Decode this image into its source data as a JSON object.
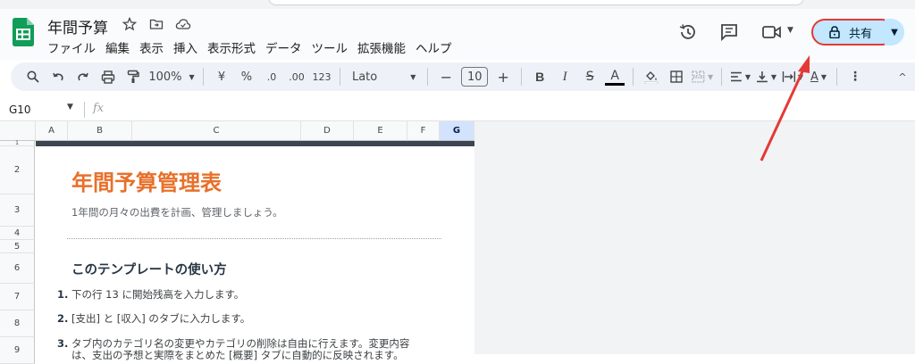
{
  "app": {
    "title": "年間予算",
    "brand_color": "#0f9d58"
  },
  "menu": [
    "ファイル",
    "編集",
    "表示",
    "挿入",
    "表示形式",
    "データ",
    "ツール",
    "拡張機能",
    "ヘルプ"
  ],
  "header_actions": {
    "share_label": "共有"
  },
  "toolbar": {
    "zoom": "100%",
    "currency": "¥",
    "percent": "%",
    "dec_decrease": ".0",
    "dec_increase": ".00",
    "number_format": "123",
    "font": "Lato",
    "font_size": "10"
  },
  "formula_bar": {
    "cell_ref": "G10",
    "fx": "fx"
  },
  "columns": [
    "A",
    "B",
    "C",
    "D",
    "E",
    "F",
    "G"
  ],
  "rows": [
    "1",
    "2",
    "3",
    "4",
    "5",
    "6",
    "7",
    "8",
    "9"
  ],
  "sheet": {
    "title": "年間予算管理表",
    "subtitle": "1年間の月々の出費を計画、管理しましょう。",
    "howto_heading": "このテンプレートの使い方",
    "steps": [
      {
        "num": "1.",
        "text": "下の行 13 に開始残高を入力します。"
      },
      {
        "num": "2.",
        "text": "[支出] と [収入] のタブに入力します。"
      },
      {
        "num": "3.",
        "text": "タブ内のカテゴリ名の変更やカテゴリの削除は自由に行えます。変更内容"
      },
      {
        "num": "",
        "text": "は、支出の予想と実際をまとめた [概要] タブに自動的に反映されます。"
      }
    ]
  },
  "colors": {
    "title_orange": "#e8702a",
    "heading_navy": "#283646",
    "share_bg": "#c2e7ff",
    "highlight_red": "#e53935"
  }
}
